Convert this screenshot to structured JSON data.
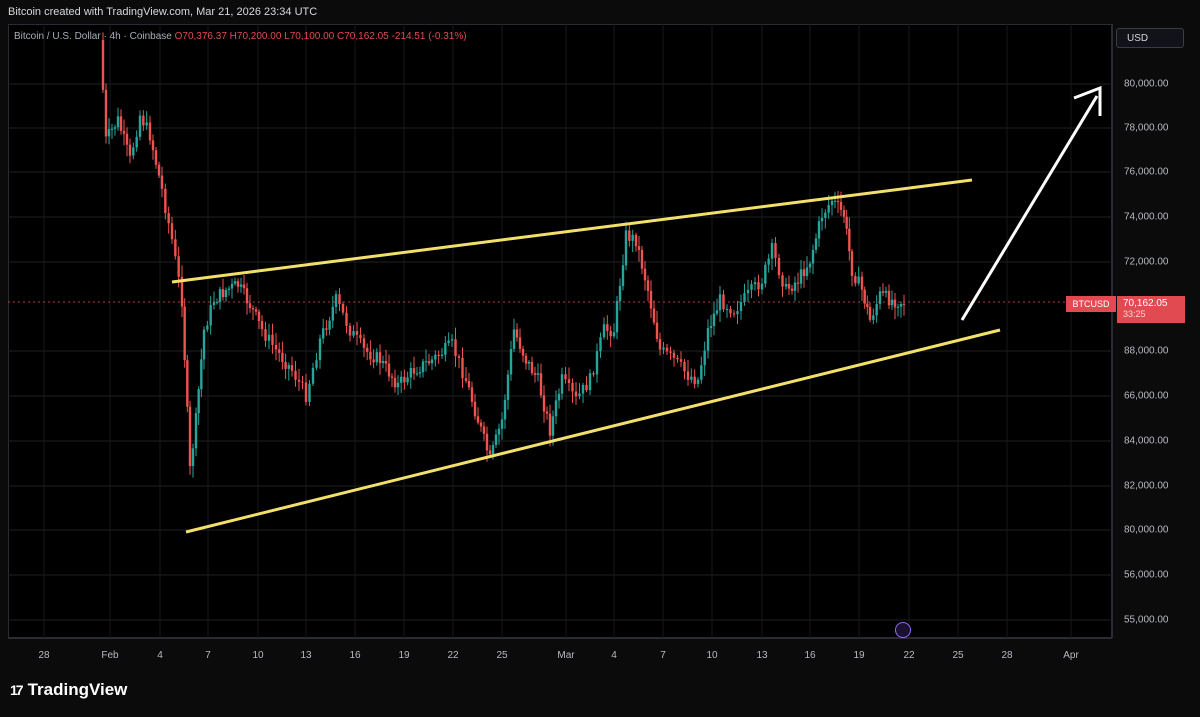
{
  "header": {
    "credit": "Bitcoin created with TradingView.com, Mar 21, 2026 23:34 UTC"
  },
  "symbol_line": {
    "name": "Bitcoin / U.S. Dollar · 4h · Coinbase",
    "open": "O70,376.37",
    "high": "H70,200.00",
    "low": "L70,100.00",
    "close": "C70,162.05",
    "change": "-214.51 (-0.31%)"
  },
  "currency": "USD",
  "price_axis_labels": [
    "80,000.00",
    "78,000.00",
    "76,000.00",
    "74,000.00",
    "72,000.00",
    "88,000.00",
    "66,000.00",
    "84,000.00",
    "82,000.00",
    "80,000.00",
    "56,000.00",
    "55,000.00"
  ],
  "time_axis_labels": [
    "28",
    "Feb",
    "4",
    "7",
    "10",
    "13",
    "16",
    "19",
    "22",
    "25",
    "Mar",
    "4",
    "7",
    "10",
    "13",
    "16",
    "19",
    "22",
    "25",
    "28",
    "Apr"
  ],
  "last_price_tag": {
    "symbol": "BTCUSD",
    "price": "70,162.05",
    "countdown": "33:25"
  },
  "brand": "TradingView",
  "colors": {
    "up": "#26a69a",
    "down": "#ef5350",
    "trendline": "#f3e06b",
    "arrow": "#ffffff",
    "last_price": "#e24a52"
  },
  "chart_data": {
    "type": "candlestick",
    "symbol": "BTCUSD",
    "interval": "4h",
    "approx_close_path": [
      {
        "date": "Jan 31",
        "price": 79000
      },
      {
        "date": "Feb 2",
        "price": 75200
      },
      {
        "date": "Feb 5",
        "price": 60500
      },
      {
        "date": "Feb 6",
        "price": 70500
      },
      {
        "date": "Feb 8",
        "price": 71300
      },
      {
        "date": "Feb 11",
        "price": 68800
      },
      {
        "date": "Feb 15",
        "price": 70300
      },
      {
        "date": "Feb 18",
        "price": 68300
      },
      {
        "date": "Feb 22",
        "price": 67800
      },
      {
        "date": "Feb 24",
        "price": 63500
      },
      {
        "date": "Feb 26",
        "price": 69400
      },
      {
        "date": "Mar 1",
        "price": 67200
      },
      {
        "date": "Mar 3",
        "price": 69300
      },
      {
        "date": "Mar 4",
        "price": 73500
      },
      {
        "date": "Mar 6",
        "price": 68700
      },
      {
        "date": "Mar 8",
        "price": 67200
      },
      {
        "date": "Mar 11",
        "price": 70800
      },
      {
        "date": "Mar 14",
        "price": 71800
      },
      {
        "date": "Mar 17",
        "price": 74700
      },
      {
        "date": "Mar 18",
        "price": 72900
      },
      {
        "date": "Mar 19",
        "price": 70200
      },
      {
        "date": "Mar 21",
        "price": 70162.05
      }
    ]
  }
}
